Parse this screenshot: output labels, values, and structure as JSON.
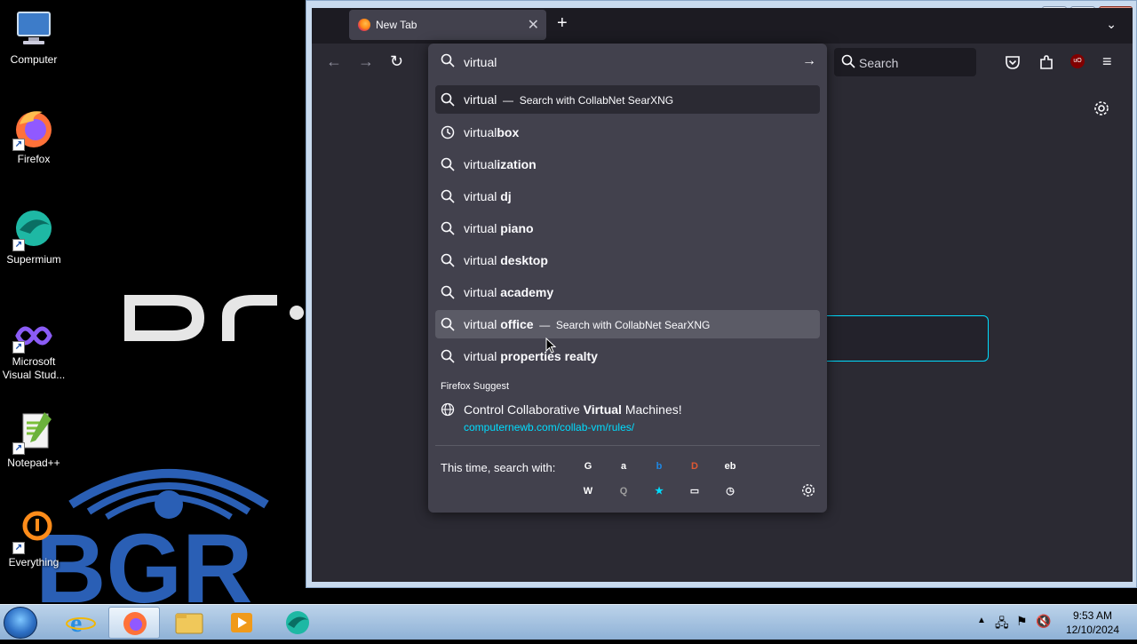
{
  "desktop": {
    "icons": [
      {
        "label": "Computer"
      },
      {
        "label": "Firefox"
      },
      {
        "label": "Supermium"
      },
      {
        "label": "Microsoft Visual Stud..."
      },
      {
        "label": "Notepad++"
      },
      {
        "label": "Everything"
      }
    ]
  },
  "browser": {
    "tab": {
      "title": "New Tab"
    },
    "search_placeholder": "Search"
  },
  "urlbar": {
    "input_value": "virtual",
    "results": [
      {
        "prefix": "virtual",
        "bold": "",
        "action": "Search with CollabNet SearXNG",
        "icon": "search-icon"
      },
      {
        "prefix": "virtual",
        "bold": "box",
        "action": "",
        "icon": "history-icon"
      },
      {
        "prefix": "virtual",
        "bold": "ization",
        "action": "",
        "icon": "search-icon"
      },
      {
        "prefix": "virtual ",
        "bold": "dj",
        "action": "",
        "icon": "search-icon"
      },
      {
        "prefix": "virtual ",
        "bold": "piano",
        "action": "",
        "icon": "search-icon"
      },
      {
        "prefix": "virtual ",
        "bold": "desktop",
        "action": "",
        "icon": "search-icon"
      },
      {
        "prefix": "virtual ",
        "bold": "academy",
        "action": "",
        "icon": "search-icon"
      },
      {
        "prefix": "virtual ",
        "bold": "office",
        "action": "Search with CollabNet SearXNG",
        "icon": "search-icon"
      },
      {
        "prefix": "virtual ",
        "bold": "properties realty",
        "action": "",
        "icon": "search-icon"
      }
    ],
    "firefox_suggest_label": "Firefox Suggest",
    "suggest": {
      "title_pre": "Control Collaborative ",
      "title_bold": "Virtual",
      "title_post": " Machines!",
      "url": "computernewb.com/collab-vm/rules/"
    },
    "oneoff_label": "This time, search with:",
    "oneoff_engines": [
      {
        "name": "google-icon",
        "glyph": "G",
        "color": "#ffffff"
      },
      {
        "name": "amazon-icon",
        "glyph": "a",
        "color": "#ffffff"
      },
      {
        "name": "bing-icon",
        "glyph": "b",
        "color": "#1e88e5"
      },
      {
        "name": "duckduckgo-icon",
        "glyph": "D",
        "color": "#de5833"
      },
      {
        "name": "ebay-icon",
        "glyph": "eb",
        "color": "#ffffff"
      },
      {
        "name": "wikipedia-icon",
        "glyph": "W",
        "color": "#ffffff"
      },
      {
        "name": "searxng-icon",
        "glyph": "Q",
        "color": "#9e9e9e"
      },
      {
        "name": "bookmarks-icon",
        "glyph": "★",
        "color": "#00ddff"
      },
      {
        "name": "tabs-icon",
        "glyph": "▭",
        "color": "#fbfbfe"
      },
      {
        "name": "history-icon",
        "glyph": "◷",
        "color": "#fbfbfe"
      }
    ]
  },
  "taskbar": {
    "time": "9:53 AM",
    "date": "12/10/2024"
  }
}
